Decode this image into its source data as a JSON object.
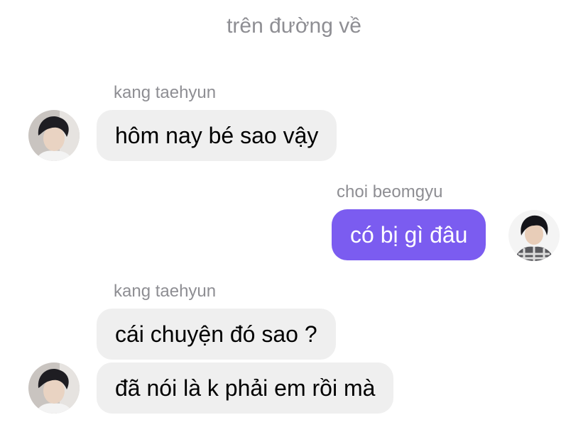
{
  "header": {
    "title": "trên đường về"
  },
  "messages": [
    {
      "sender": "kang taehyun",
      "text": "hôm nay bé sao vậy",
      "direction": "incoming"
    },
    {
      "sender": "choi beomgyu",
      "text": "có bị gì đâu",
      "direction": "outgoing"
    },
    {
      "sender": "kang taehyun",
      "text": "cái chuyện đó sao ?",
      "direction": "incoming"
    },
    {
      "text": "đã nói là k phải em rồi mà",
      "direction": "incoming"
    }
  ],
  "colors": {
    "outgoing_bubble": "#7b5cf0",
    "incoming_bubble": "#efefef",
    "meta_text": "#8e8e93"
  }
}
